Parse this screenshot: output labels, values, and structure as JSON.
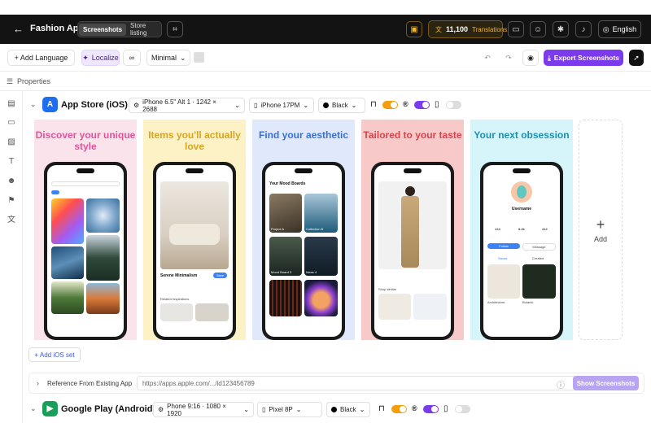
{
  "app": {
    "title": "Fashion App"
  },
  "header": {
    "tabs": [
      {
        "label": "Screenshots"
      },
      {
        "label": "Store listing"
      }
    ],
    "credits": {
      "count": "11,100",
      "label": "Translations"
    },
    "language": "English"
  },
  "toolbar": {
    "add_language": "+ Add Language",
    "localize": "Localize",
    "font_select": "Minimal",
    "export": "Export Screenshots"
  },
  "properties": {
    "label": "Properties"
  },
  "ios": {
    "platform": "App Store (iOS)",
    "device_size": "iPhone 6.5\" Alt 1 · 1242 × 2688",
    "device_model": "iPhone 17PM",
    "frame_color": "Black",
    "add_set": "+ Add iOS set",
    "add_label": "Add",
    "cards": [
      {
        "headline": "Discover your unique style",
        "bg": "#fbe3ec",
        "color": "#e0559a"
      },
      {
        "headline": "Items you'll actually love",
        "bg": "#fdf1c6",
        "color": "#d8a520"
      },
      {
        "headline": "Find your aesthetic",
        "bg": "#dfe9fb",
        "color": "#3a6fd8"
      },
      {
        "headline": "Tailored to your taste",
        "bg": "#f7c9c9",
        "color": "#d9434d"
      },
      {
        "headline": "Your next obsession",
        "bg": "#d5f5fa",
        "color": "#1c8fb0"
      }
    ],
    "screens": {
      "s2": {
        "title": "Serene Minimalism",
        "save": "Save",
        "related": "Related Inspirations"
      },
      "s3": {
        "title": "Your Mood Boards",
        "items": [
          "Project A",
          "Collection B",
          "Mood Board 3",
          "Ideas 4"
        ]
      },
      "s4": {
        "shop": "Shop similar"
      },
      "s5": {
        "username": "Username",
        "stats": [
          "124",
          "8.2k",
          "412"
        ],
        "follow": "Follow",
        "message": "Message",
        "tabs": [
          "Saved",
          "Created"
        ],
        "items": [
          "Architecture",
          "Botanic"
        ]
      }
    }
  },
  "reference": {
    "label": "Reference From Existing App",
    "placeholder": "https://apps.apple.com/.../id123456789",
    "button": "Show Screenshots"
  },
  "android": {
    "platform": "Google Play (Android)",
    "device_size": "Phone 9:16 · 1080 × 1920",
    "device_model": "Pixel 8P",
    "frame_color": "Black"
  },
  "colors": {
    "accent": "#7c3aed",
    "orange": "#f59e0b",
    "purple": "#7c3aed"
  }
}
